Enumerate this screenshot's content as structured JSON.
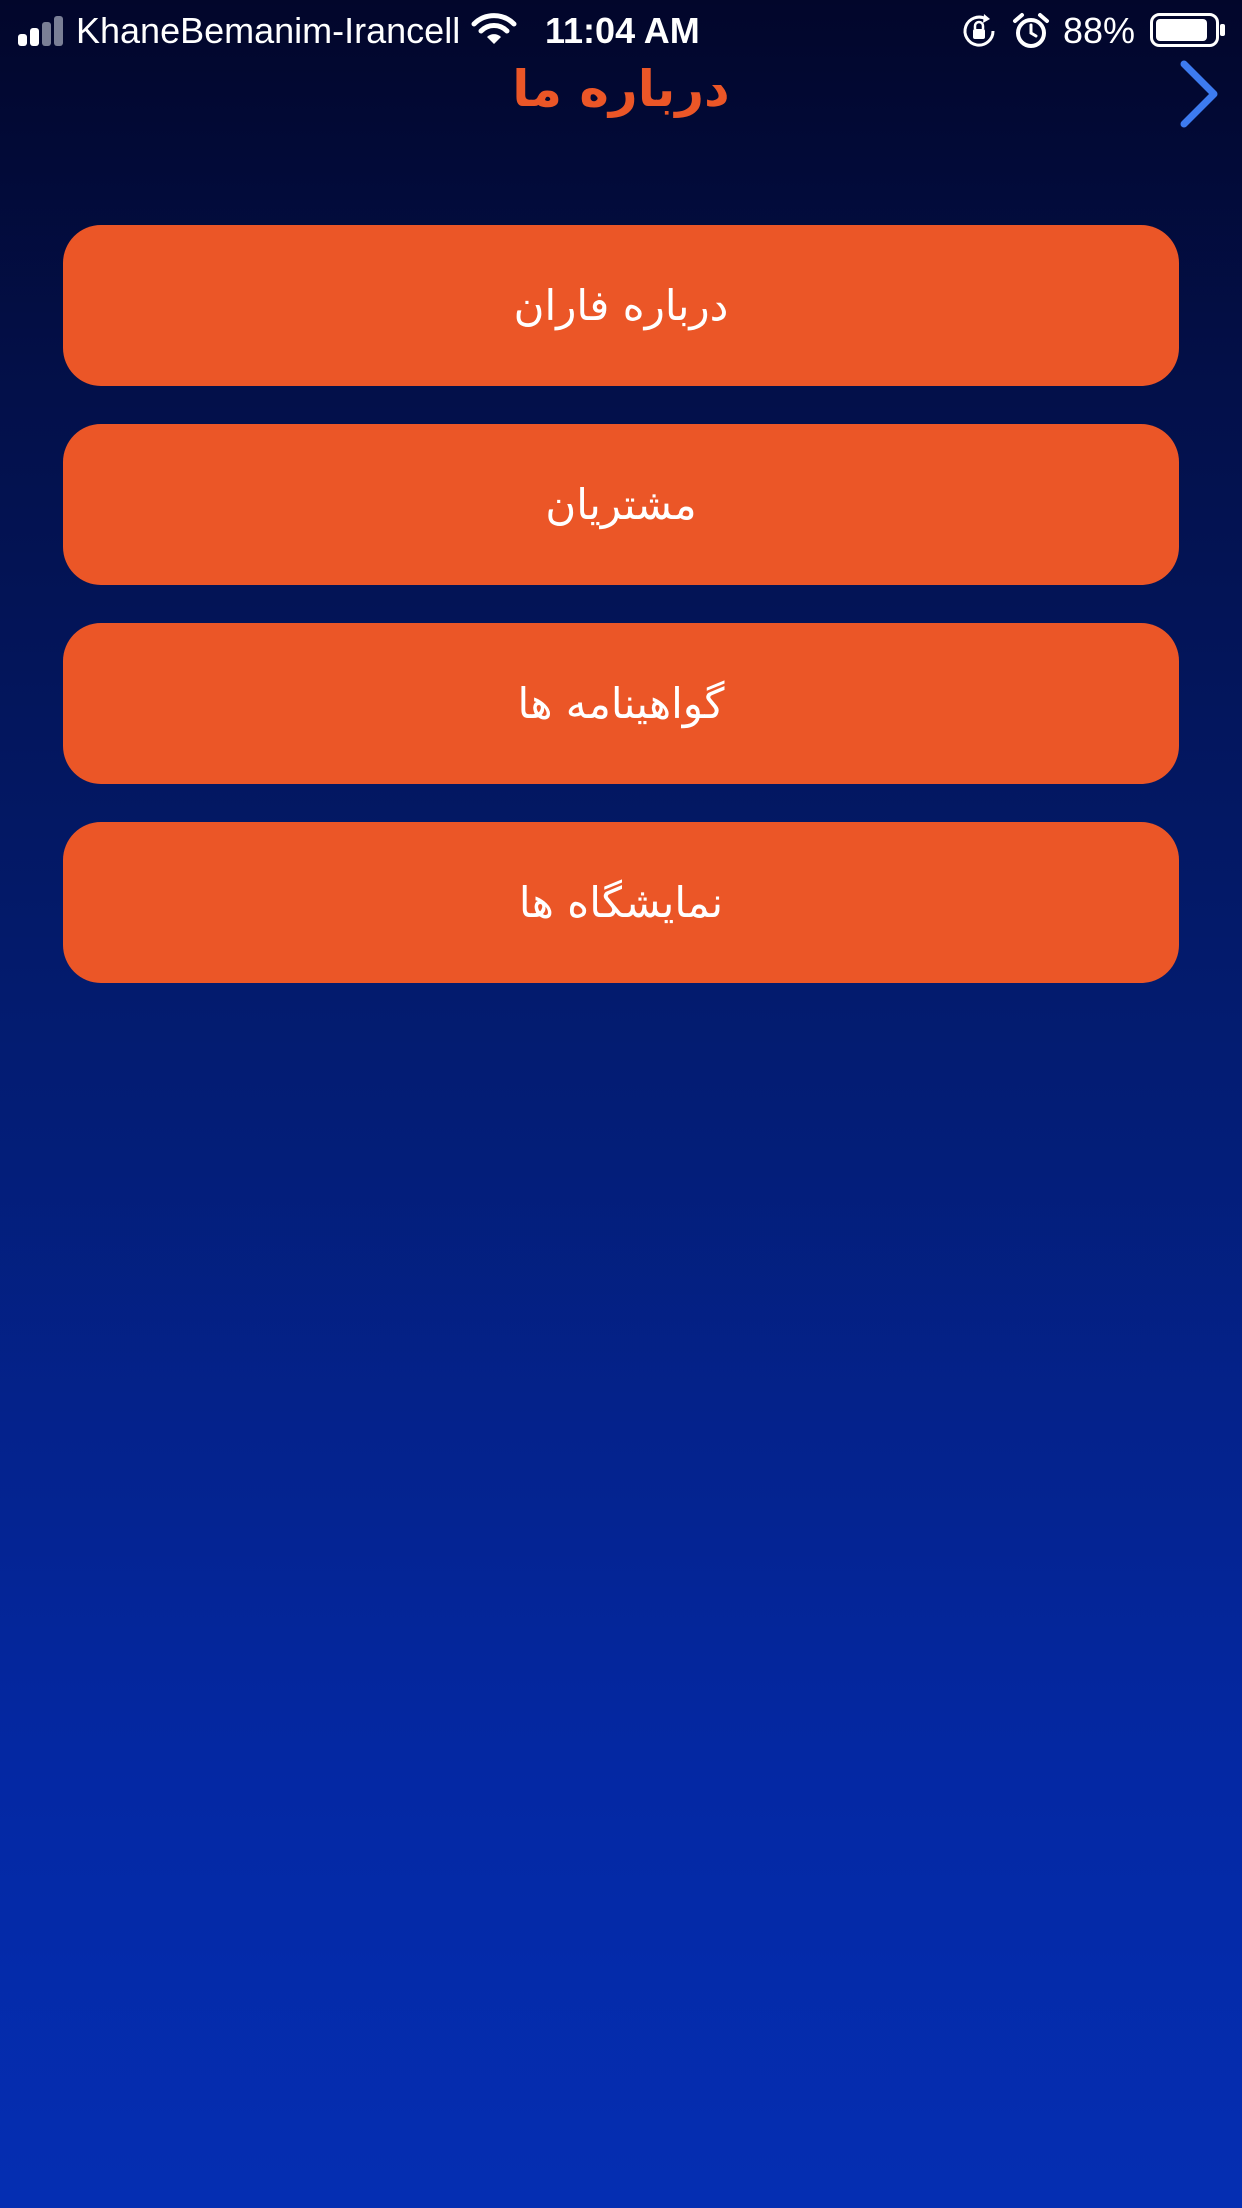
{
  "status_bar": {
    "carrier": "KhaneBemanim-Irancell",
    "time": "11:04 AM",
    "battery_percent": "88%",
    "battery_level": 0.88,
    "signal_bars_active": 2,
    "signal_bars_total": 4
  },
  "header": {
    "title": "درباره ما",
    "back_icon": "chevron-right-icon"
  },
  "menu": {
    "items": [
      {
        "label": "درباره فاران"
      },
      {
        "label": "مشتریان"
      },
      {
        "label": "گواهینامه ها"
      },
      {
        "label": "نمایشگاه ها"
      }
    ]
  },
  "colors": {
    "accent": "#eb5627",
    "back_chevron": "#3d7bf0",
    "background_top": "#02062b",
    "background_bottom": "#052eb2"
  }
}
